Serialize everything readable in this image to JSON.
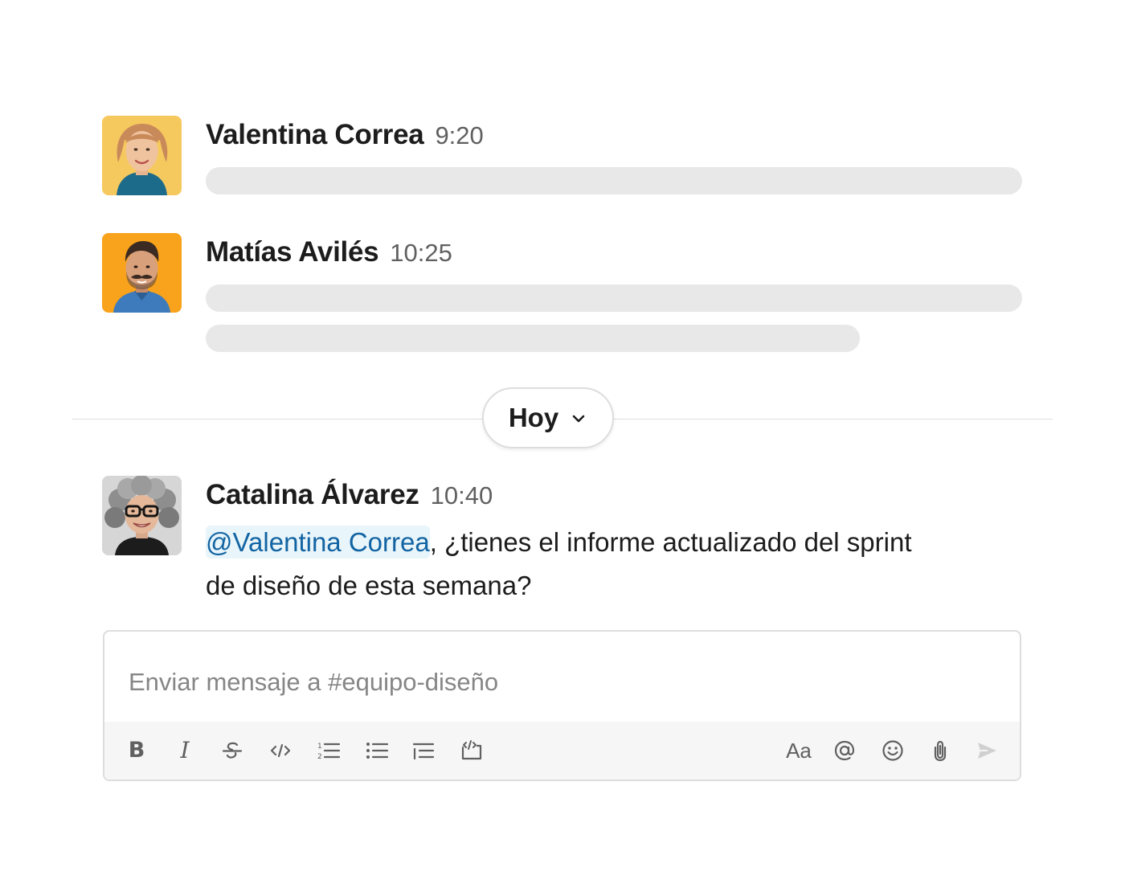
{
  "messages": [
    {
      "sender": "Valentina Correa",
      "time": "9:20",
      "avatar_bg": "#f6c95e"
    },
    {
      "sender": "Matías Avilés",
      "time": "10:25",
      "avatar_bg": "#f9a21b"
    },
    {
      "sender": "Catalina Álvarez",
      "time": "10:40",
      "mention": "@Valentina Correa",
      "text_line1": ", ¿tienes el informe actualizado del sprint",
      "text_line2": "de diseño de esta semana?",
      "avatar_bg": "#d6d6d6"
    }
  ],
  "divider": {
    "label": "Hoy"
  },
  "composer": {
    "placeholder": "Enviar mensaje a #equipo-diseño",
    "value": "",
    "format_text_label": "Aa",
    "tools": [
      "bold-icon",
      "italic-icon",
      "strikethrough-icon",
      "code-icon",
      "ordered-list-icon",
      "bullet-list-icon",
      "blockquote-icon",
      "code-block-icon",
      "format-text-icon",
      "mention-icon",
      "emoji-icon",
      "attach-icon",
      "send-icon"
    ]
  },
  "colors": {
    "mention_text": "#1264a3",
    "mention_bg": "#e8f5fa",
    "skeleton": "#e8e8e8",
    "border": "#dddddd"
  }
}
